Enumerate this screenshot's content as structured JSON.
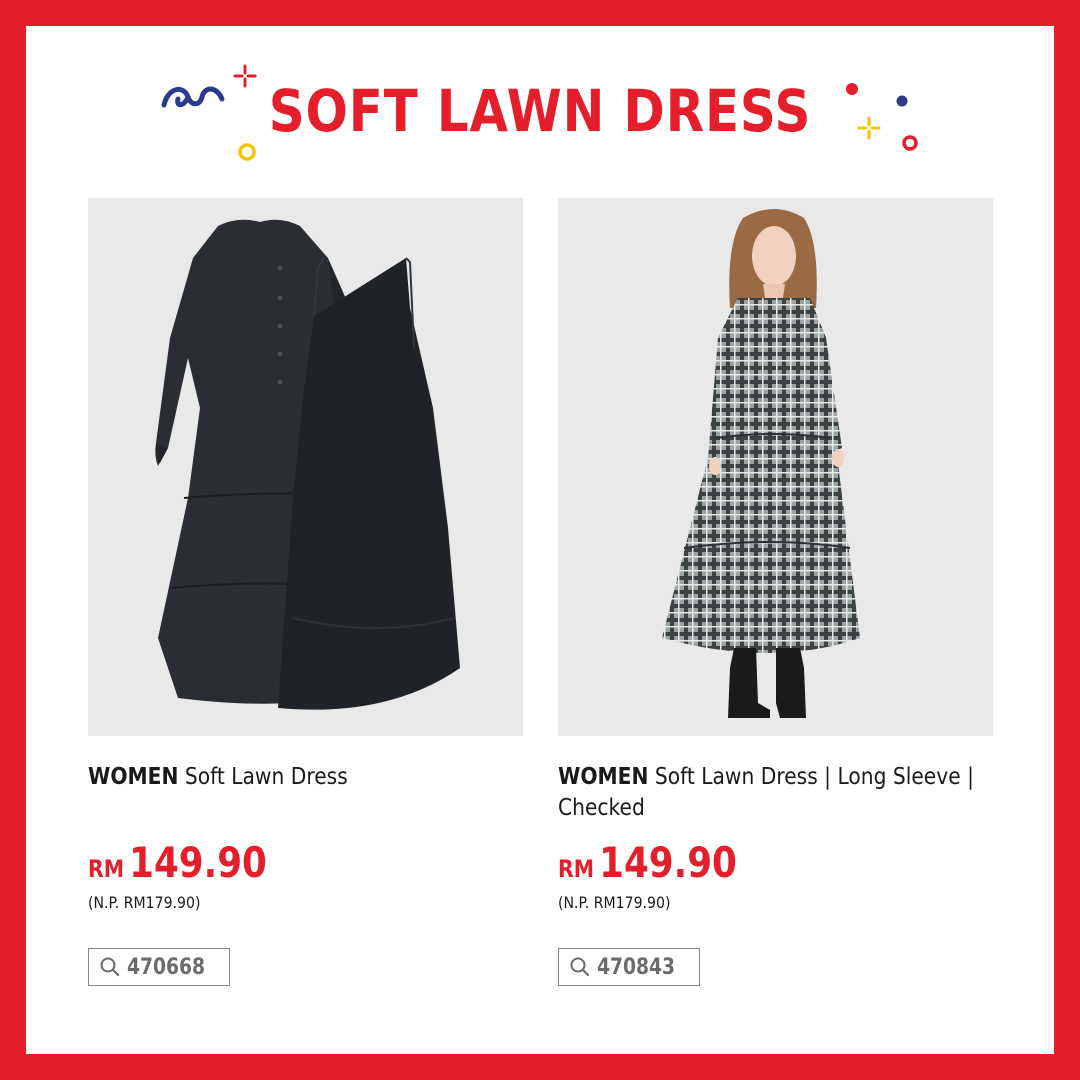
{
  "header": {
    "title": "SOFT LAWN DRESS",
    "brand_color": "#e41f2b",
    "accent_colors": [
      "#e41f2b",
      "#2b3a8f",
      "#f2c400"
    ]
  },
  "products": [
    {
      "category": "WOMEN",
      "name": "Soft Lawn Dress",
      "currency": "RM",
      "price": "149.90",
      "normal_price": "(N.P. RM179.90)",
      "product_code": "470668",
      "image_icon": "black-tiered-dress-image"
    },
    {
      "category": "WOMEN",
      "name": "Soft Lawn Dress | Long Sleeve | Checked",
      "currency": "RM",
      "price": "149.90",
      "normal_price": "(N.P. RM179.90)",
      "product_code": "470843",
      "image_icon": "checked-dress-model-image"
    }
  ]
}
